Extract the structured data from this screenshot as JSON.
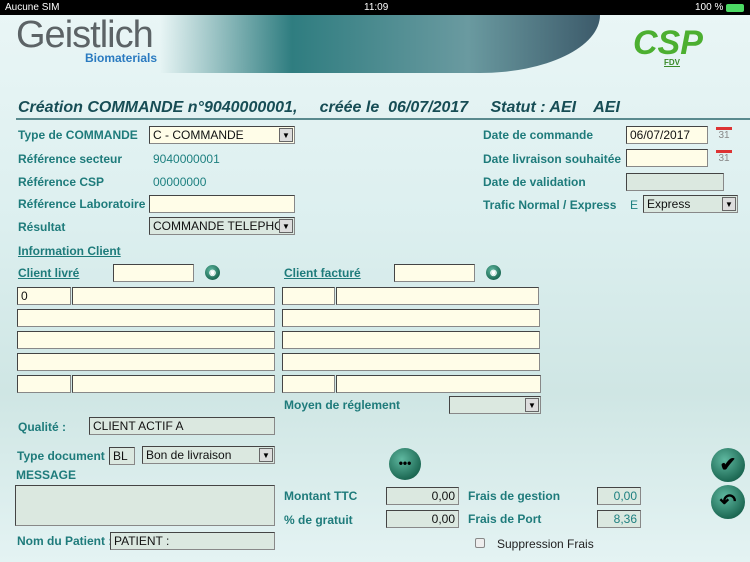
{
  "status_bar": {
    "carrier": "Aucune SIM",
    "time": "11:09",
    "battery": "100 %"
  },
  "header": {
    "brand": "Geistlich",
    "brand_sub": "Biomaterials",
    "partner_logo": "CSP",
    "partner_sub": "FDV"
  },
  "title": {
    "creation": "Création COMMANDE n°9040000001,",
    "created": "créée le  06/07/2017",
    "statut": "Statut : AEI",
    "statut2": "AEI"
  },
  "form": {
    "type_commande": {
      "label": "Type de COMMANDE",
      "value": "C - COMMANDE"
    },
    "ref_secteur": {
      "label": "Référence secteur",
      "value": "9040000001"
    },
    "ref_csp": {
      "label": "Référence CSP",
      "value": "00000000"
    },
    "ref_labo": {
      "label": "Référence Laboratoire",
      "value": ""
    },
    "resultat": {
      "label": "Résultat",
      "value": "COMMANDE TELEPHO"
    },
    "date_commande": {
      "label": "Date de commande",
      "value": "06/07/2017"
    },
    "date_livraison": {
      "label": "Date livraison souhaitée",
      "value": ""
    },
    "date_validation": {
      "label": "Date de validation",
      "value": ""
    },
    "trafic": {
      "label": "Trafic Normal / Express",
      "code": "E",
      "value": "Express"
    },
    "calendar_icon": "31"
  },
  "client": {
    "section": "Information Client",
    "livre_label": "Client livré",
    "facture_label": "Client facturé",
    "livre_code": "0"
  },
  "moyen_reglement": {
    "label": "Moyen de réglement",
    "value": ""
  },
  "qualite": {
    "label": "Qualité :",
    "value": "CLIENT ACTIF A"
  },
  "type_document": {
    "label": "Type document",
    "code": "BL",
    "value": "Bon de livraison"
  },
  "message": {
    "label": "MESSAGE",
    "value": ""
  },
  "patient": {
    "label": "Nom du Patient :",
    "value": "PATIENT :"
  },
  "totals": {
    "montant_label": "Montant TTC",
    "montant": "0,00",
    "gratuit_label": "% de gratuit",
    "gratuit": "0,00",
    "gestion_label": "Frais de gestion",
    "gestion": "0,00",
    "port_label": "Frais de Port",
    "port": "8,36",
    "suppression_label": "Suppression Frais"
  },
  "buttons": {
    "more": "•••",
    "validate": "✔",
    "back": "↶",
    "search": "◉",
    "arrow": "▼"
  }
}
